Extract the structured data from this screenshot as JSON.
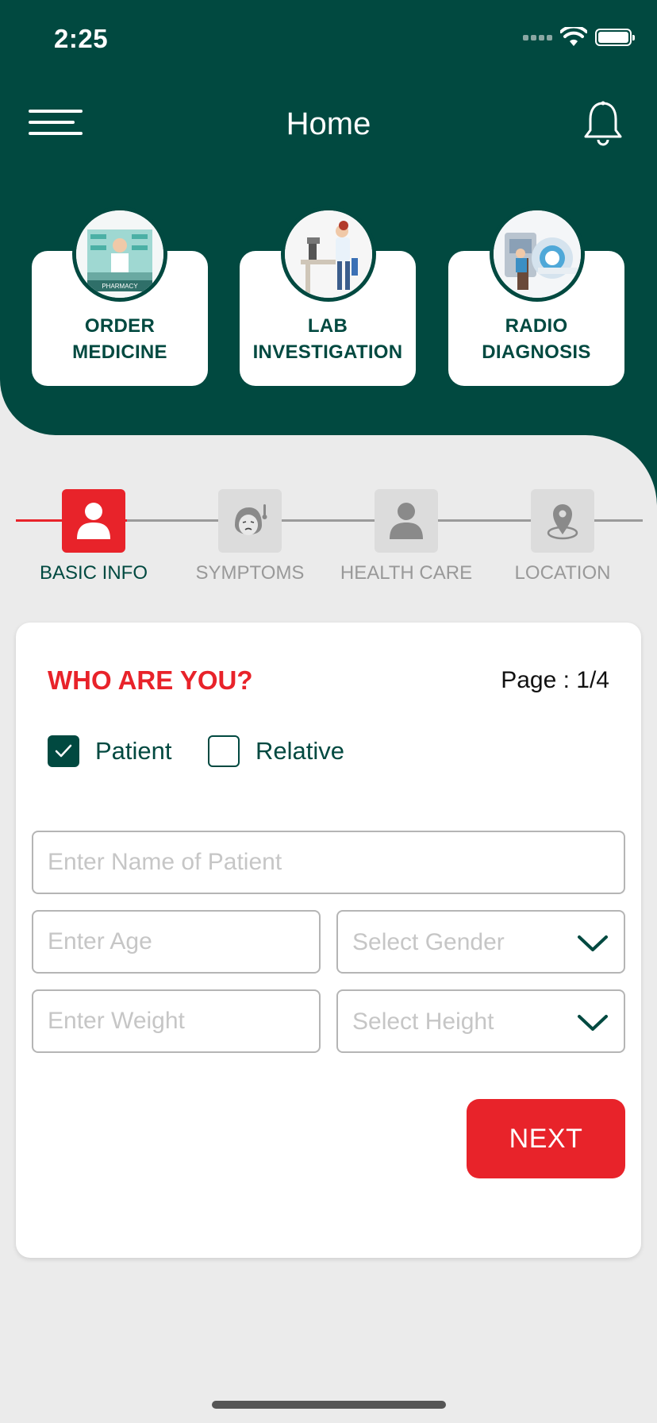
{
  "status_bar": {
    "time": "2:25"
  },
  "header": {
    "title": "Home"
  },
  "services": [
    {
      "label": "ORDER\nMEDICINE",
      "icon": "pharmacy-icon"
    },
    {
      "label": "LAB\nINVESTIGATION",
      "icon": "microscope-icon"
    },
    {
      "label": "RADIO\nDIAGNOSIS",
      "icon": "mri-scanner-icon"
    }
  ],
  "steps": [
    {
      "label": "BASIC INFO",
      "active": true,
      "icon": "person-icon"
    },
    {
      "label": "SYMPTOMS",
      "active": false,
      "icon": "sick-face-icon"
    },
    {
      "label": "HEALTH CARE",
      "active": false,
      "icon": "person-icon"
    },
    {
      "label": "LOCATION",
      "active": false,
      "icon": "location-pin-icon"
    }
  ],
  "form": {
    "title": "WHO ARE YOU?",
    "page": "Page : 1/4",
    "options": [
      {
        "label": "Patient",
        "checked": true
      },
      {
        "label": "Relative",
        "checked": false
      }
    ],
    "name_placeholder": "Enter Name of Patient",
    "age_placeholder": "Enter Age",
    "gender_placeholder": "Select Gender",
    "weight_placeholder": "Enter Weight",
    "height_placeholder": "Select Height",
    "next_label": "NEXT"
  },
  "colors": {
    "primary": "#014940",
    "accent": "#e8232a",
    "background": "#ebebeb"
  }
}
